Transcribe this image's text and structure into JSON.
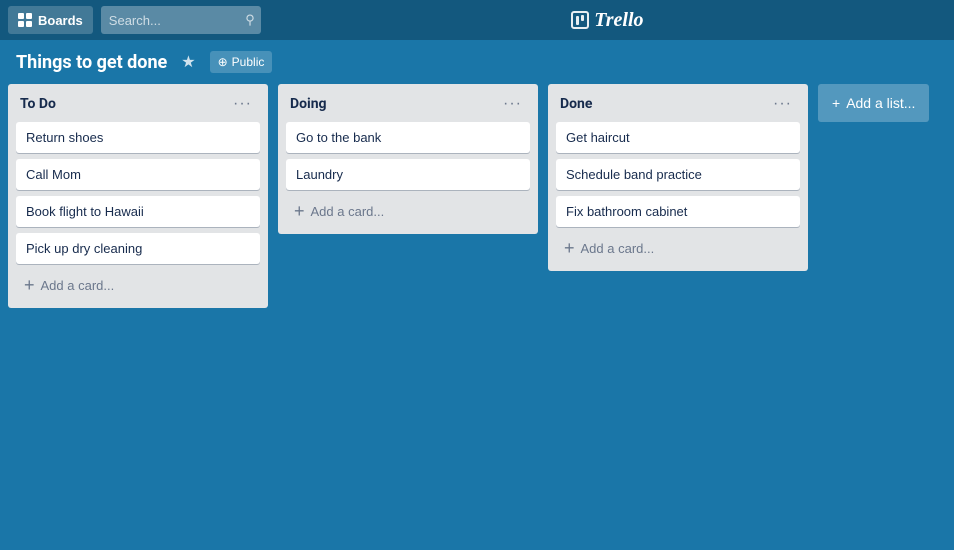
{
  "nav": {
    "boards_label": "Boards",
    "search_placeholder": "Search...",
    "logo_text": "Trello"
  },
  "board": {
    "title": "Things to get done",
    "visibility": "Public",
    "add_list_label": "Add a list..."
  },
  "lists": [
    {
      "id": "todo",
      "title": "To Do",
      "cards": [
        {
          "id": "card-1",
          "text": "Return shoes"
        },
        {
          "id": "card-2",
          "text": "Call Mom"
        },
        {
          "id": "card-3",
          "text": "Book flight to Hawaii"
        },
        {
          "id": "card-4",
          "text": "Pick up dry cleaning"
        }
      ],
      "add_card_label": "Add a card..."
    },
    {
      "id": "doing",
      "title": "Doing",
      "cards": [
        {
          "id": "card-5",
          "text": "Go to the bank"
        },
        {
          "id": "card-6",
          "text": "Laundry"
        }
      ],
      "add_card_label": "Add a card..."
    },
    {
      "id": "done",
      "title": "Done",
      "cards": [
        {
          "id": "card-7",
          "text": "Get haircut"
        },
        {
          "id": "card-8",
          "text": "Schedule band practice"
        },
        {
          "id": "card-9",
          "text": "Fix bathroom cabinet"
        }
      ],
      "add_card_label": "Add a card..."
    }
  ],
  "icons": {
    "star": "★",
    "globe": "⊕",
    "ellipsis": "···",
    "plus": "+",
    "search": "🔍"
  }
}
